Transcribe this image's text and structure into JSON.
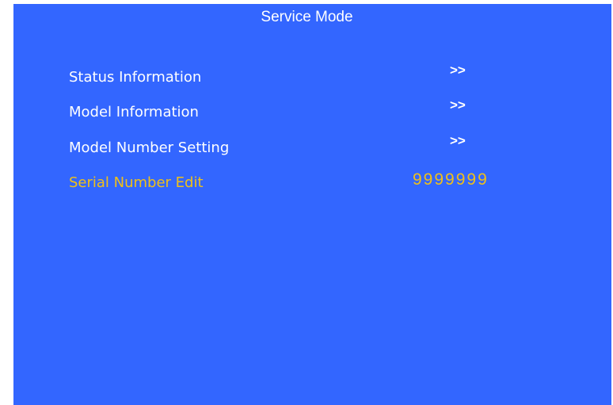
{
  "title": "Service Mode",
  "colors": {
    "background": "#3366ff",
    "text": "#ffffff",
    "selected": "#f0c018"
  },
  "menu": {
    "items": [
      {
        "label": "Status Information",
        "value": ">>"
      },
      {
        "label": "Model Information",
        "value": ">>"
      },
      {
        "label": "Model Number Setting",
        "value": ">>"
      },
      {
        "label": "Serial Number Edit",
        "value": "9999999",
        "selected": true
      }
    ]
  }
}
